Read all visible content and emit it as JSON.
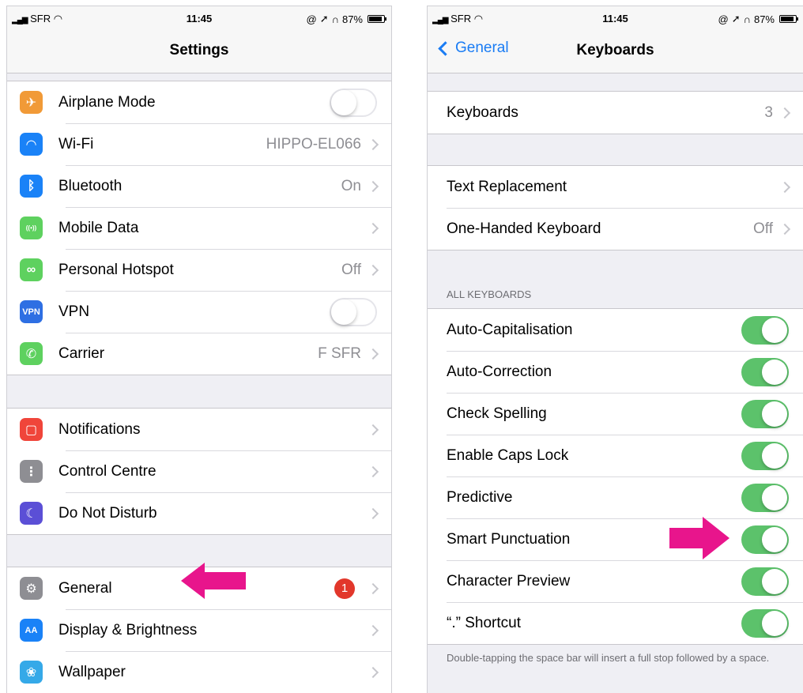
{
  "status": {
    "carrier": "SFR",
    "time": "11:45",
    "battery": "87%"
  },
  "left": {
    "title": "Settings",
    "group1": [
      {
        "name": "airplane",
        "label": "Airplane Mode",
        "control": "toggle",
        "on": false,
        "icon": "airplane-icon",
        "color": "#f19a37"
      },
      {
        "name": "wifi",
        "label": "Wi-Fi",
        "value": "HIPPO-EL066",
        "control": "chevron",
        "icon": "wifi-icon",
        "color": "#1a82f7"
      },
      {
        "name": "bluetooth",
        "label": "Bluetooth",
        "value": "On",
        "control": "chevron",
        "icon": "bluetooth-icon",
        "color": "#1a82f7"
      },
      {
        "name": "mobile-data",
        "label": "Mobile Data",
        "value": "",
        "control": "chevron",
        "icon": "antenna-icon",
        "color": "#5ed15f"
      },
      {
        "name": "hotspot",
        "label": "Personal Hotspot",
        "value": "Off",
        "control": "chevron",
        "icon": "hotspot-icon",
        "color": "#5ed15f"
      },
      {
        "name": "vpn",
        "label": "VPN",
        "control": "toggle",
        "on": false,
        "icon": "vpn-icon",
        "icon_text": "VPN",
        "color": "#2e6fe3"
      },
      {
        "name": "carrier",
        "label": "Carrier",
        "value": "F SFR",
        "control": "chevron",
        "icon": "phone-icon",
        "color": "#5ed15f"
      }
    ],
    "group2": [
      {
        "name": "notifications",
        "label": "Notifications",
        "value": "",
        "control": "chevron",
        "icon": "notifications-icon",
        "color": "#f0453a"
      },
      {
        "name": "control-centre",
        "label": "Control Centre",
        "value": "",
        "control": "chevron",
        "icon": "switches-icon",
        "color": "#8e8e93"
      },
      {
        "name": "do-not-disturb",
        "label": "Do Not Disturb",
        "value": "",
        "control": "chevron",
        "icon": "moon-icon",
        "color": "#5b4fd6"
      }
    ],
    "group3": [
      {
        "name": "general",
        "label": "General",
        "badge": "1",
        "control": "chevron",
        "icon": "gear-icon",
        "color": "#8e8e93"
      },
      {
        "name": "display",
        "label": "Display & Brightness",
        "value": "",
        "control": "chevron",
        "icon": "display-icon",
        "icon_text": "AA",
        "color": "#1a82f7"
      },
      {
        "name": "wallpaper",
        "label": "Wallpaper",
        "value": "",
        "control": "chevron",
        "icon": "wallpaper-icon",
        "color": "#35a9e8"
      }
    ]
  },
  "right": {
    "back_label": "General",
    "title": "Keyboards",
    "group1": [
      {
        "name": "keyboards",
        "label": "Keyboards",
        "value": "3",
        "control": "chevron"
      }
    ],
    "group2": [
      {
        "name": "text-replacement",
        "label": "Text Replacement",
        "value": "",
        "control": "chevron"
      },
      {
        "name": "one-handed",
        "label": "One-Handed Keyboard",
        "value": "Off",
        "control": "chevron"
      }
    ],
    "section_header": "ALL KEYBOARDS",
    "group3": [
      {
        "name": "auto-capitalisation",
        "label": "Auto-Capitalisation",
        "control": "toggle",
        "on": true
      },
      {
        "name": "auto-correction",
        "label": "Auto-Correction",
        "control": "toggle",
        "on": true
      },
      {
        "name": "check-spelling",
        "label": "Check Spelling",
        "control": "toggle",
        "on": true
      },
      {
        "name": "enable-caps-lock",
        "label": "Enable Caps Lock",
        "control": "toggle",
        "on": true
      },
      {
        "name": "predictive",
        "label": "Predictive",
        "control": "toggle",
        "on": true
      },
      {
        "name": "smart-punctuation",
        "label": "Smart Punctuation",
        "control": "toggle",
        "on": true
      },
      {
        "name": "character-preview",
        "label": "Character Preview",
        "control": "toggle",
        "on": true
      },
      {
        "name": "period-shortcut",
        "label": "“.” Shortcut",
        "control": "toggle",
        "on": true
      }
    ],
    "footer": "Double-tapping the space bar will insert a full stop followed by a space."
  },
  "colors": {
    "accent": "#1a7cf4",
    "toggle_on": "#5cc26b",
    "arrow": "#e8158c"
  }
}
